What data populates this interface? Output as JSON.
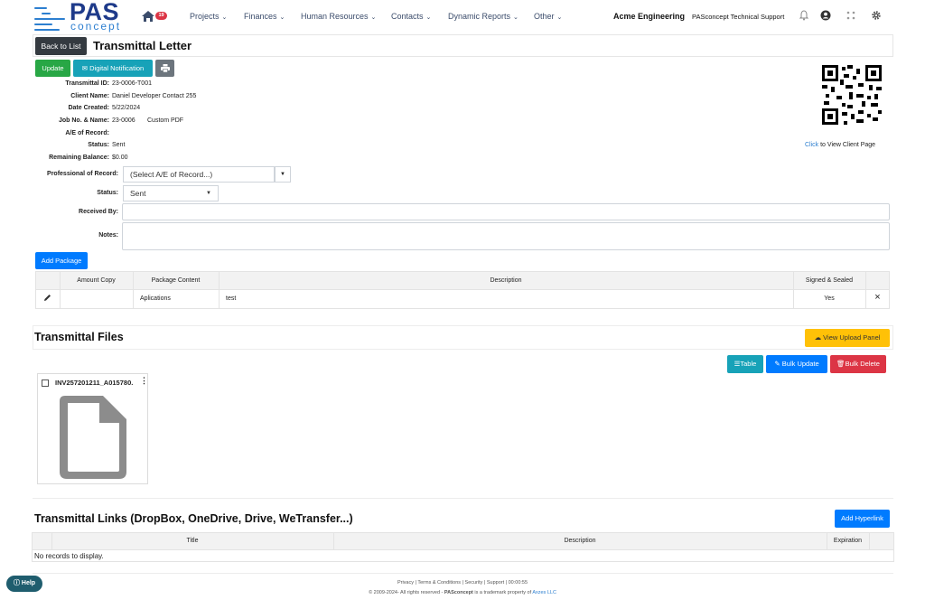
{
  "nav": {
    "logo_main": "PAS",
    "logo_sub": "concept",
    "home_badge": "19",
    "items": [
      {
        "label": "Projects"
      },
      {
        "label": "Finances"
      },
      {
        "label": "Human Resources"
      },
      {
        "label": "Contacts"
      },
      {
        "label": "Dynamic Reports"
      },
      {
        "label": "Other"
      }
    ],
    "company": "Acme Engineering",
    "support": "PASconcept Technical Support"
  },
  "header": {
    "back_label": "Back to List",
    "title": "Transmittal Letter"
  },
  "actions": {
    "update": "Update",
    "digital_notification": "Digital Notification"
  },
  "details": {
    "transmittal_id_label": "Transmittal ID:",
    "transmittal_id": "23-0006-T001",
    "client_name_label": "Client Name:",
    "client_name": "Daniel Developer Contact 255",
    "date_created_label": "Date Created:",
    "date_created": "5/22/2024",
    "job_label": "Job No. & Name:",
    "job_no": "23-0006",
    "job_name": "Custom PDF",
    "ae_label": "A/E of Record:",
    "status_label": "Status:",
    "status": "Sent",
    "balance_label": "Remaining Balance:",
    "balance": "$0.00"
  },
  "client_page": {
    "link": "Click",
    "text": " to View Client Page"
  },
  "form": {
    "professional_label": "Professional of Record:",
    "professional_value": "(Select A/E of Record...)",
    "status_label": "Status:",
    "status_value": "Sent",
    "received_label": "Received By:",
    "notes_label": "Notes:"
  },
  "packages": {
    "add_label": "Add Package",
    "headers": [
      "Amount Copy",
      "Package Content",
      "Description",
      "Signed & Sealed"
    ],
    "rows": [
      {
        "amount": "",
        "content": "Aplications",
        "description": "test",
        "signed": "Yes"
      }
    ]
  },
  "files": {
    "title": "Transmittal Files",
    "upload_label": "View Upload Panel",
    "table_label": "Table",
    "bulk_update_label": "Bulk Update",
    "bulk_delete_label": "Bulk Delete",
    "file_name": "INV257201211_A015780."
  },
  "links": {
    "title": "Transmittal Links (DropBox, OneDrive, Drive, WeTransfer...)",
    "add_label": "Add Hyperlink",
    "headers": [
      "Title",
      "Description",
      "Expiration"
    ],
    "empty": "No records to display."
  },
  "footer": {
    "line1": "Privacy | Terms & Conditions | Security | Support | 00:00:55",
    "line2_a": "© 2009-2024- All rights reserved - ",
    "line2_b": "PASconcept",
    "line2_c": " is a trademark property of ",
    "line2_d": "Axzes LLC"
  },
  "help": {
    "label": "Help"
  },
  "colors": {
    "primary": "#007bff",
    "success": "#28a745",
    "info": "#17a2b8",
    "warning": "#ffc107",
    "danger": "#dc3545",
    "dark": "#343a40"
  }
}
